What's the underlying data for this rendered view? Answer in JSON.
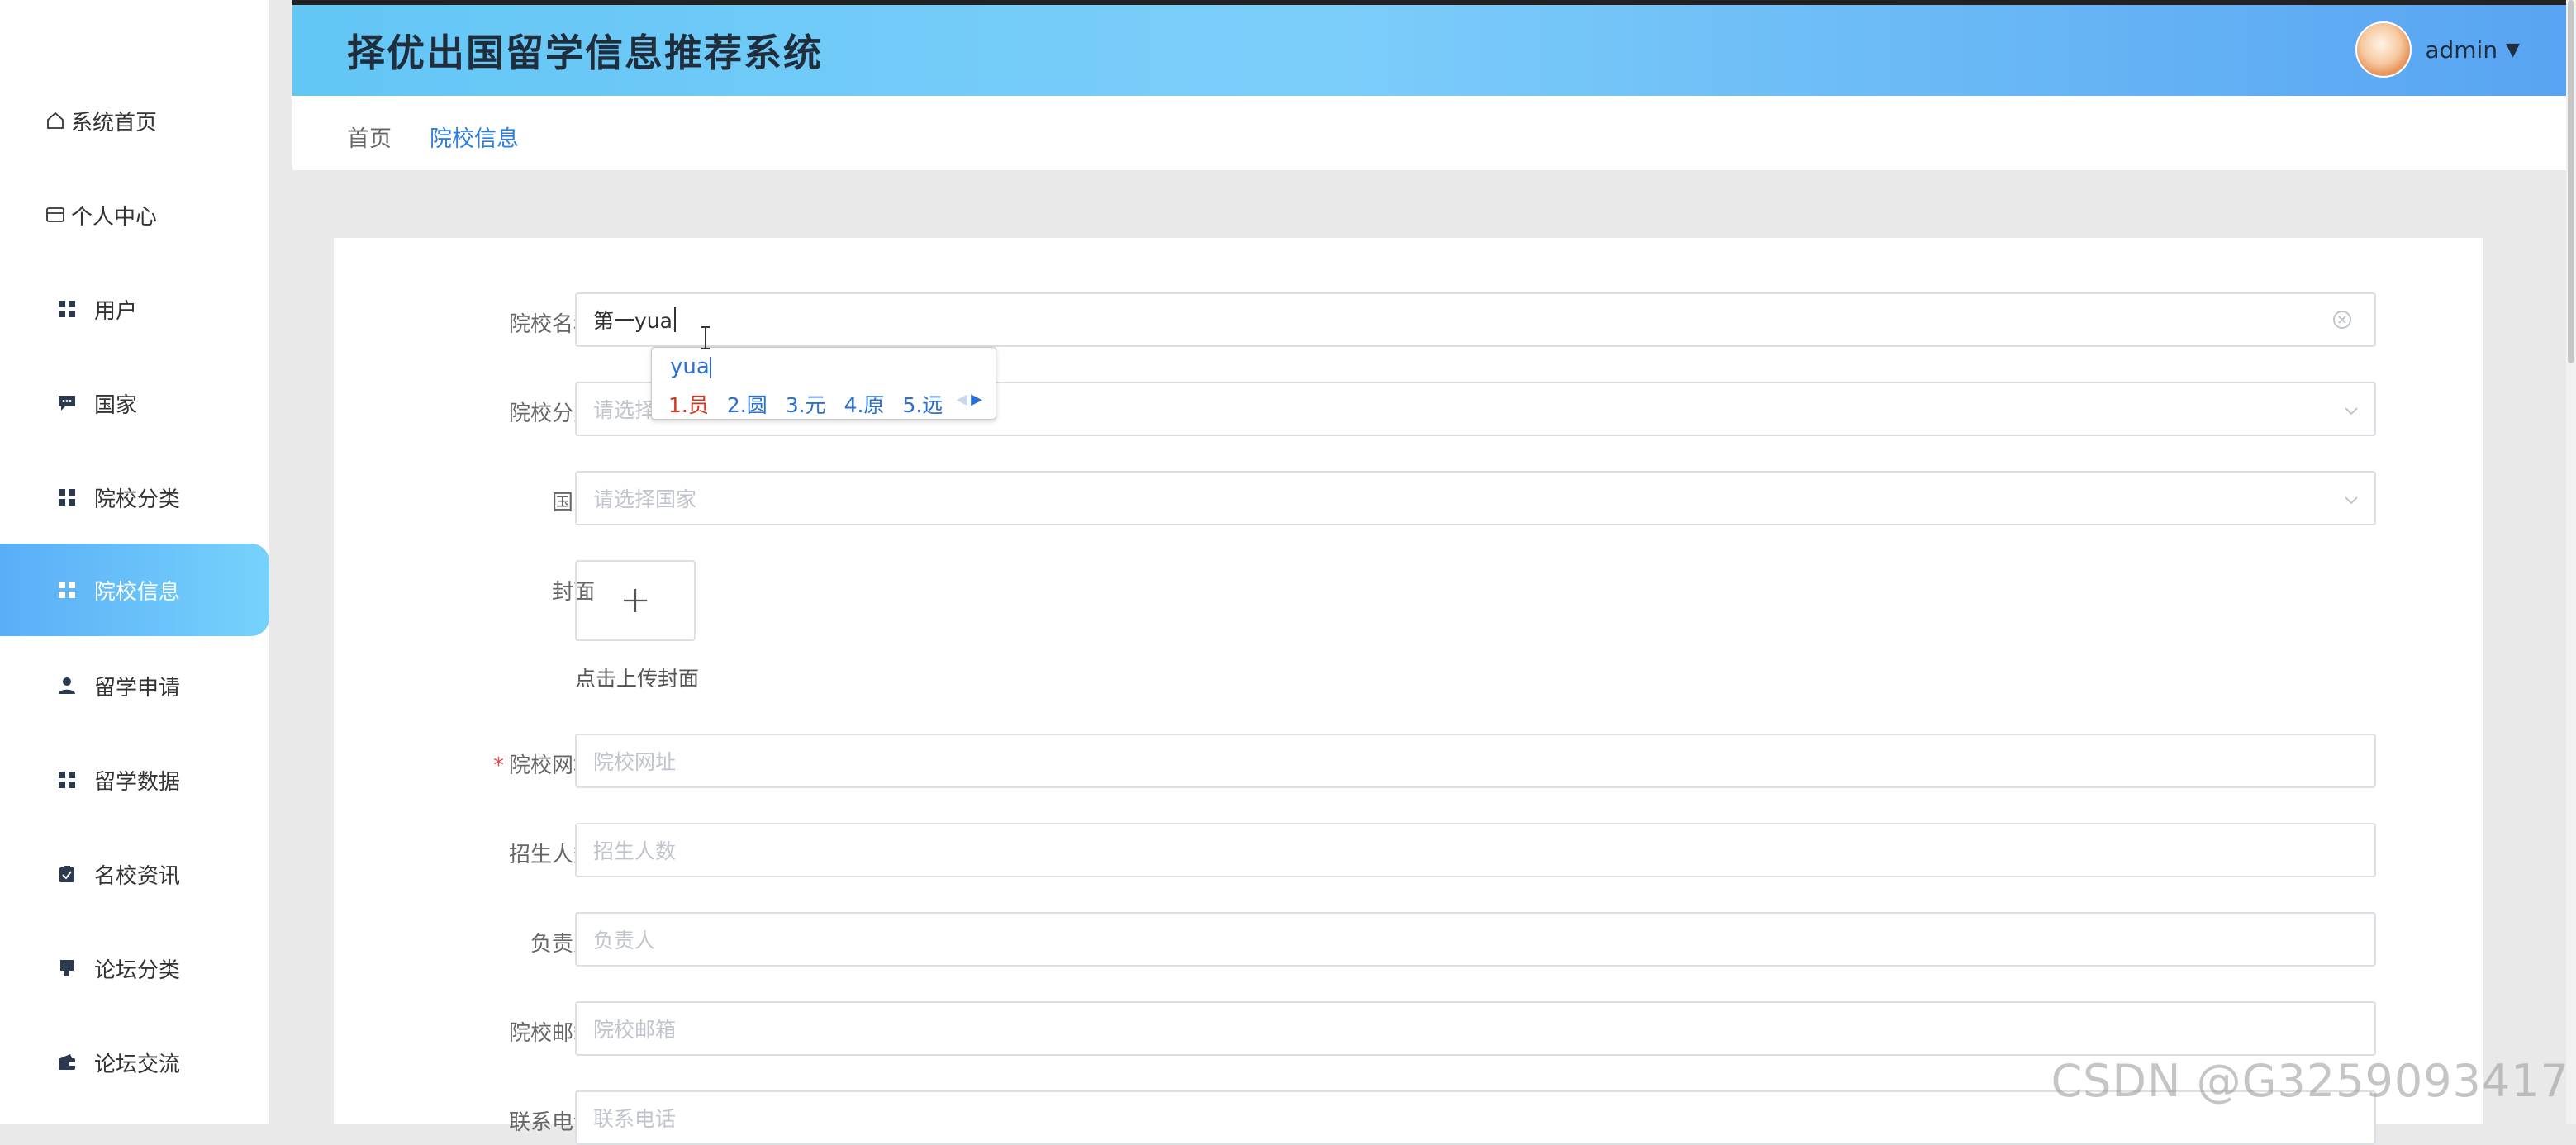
{
  "header": {
    "title": "择优出国留学信息推荐系统",
    "user_name": "admin"
  },
  "sidebar": {
    "items": [
      {
        "label": "系统首页",
        "icon": "home-icon"
      },
      {
        "label": "个人中心",
        "icon": "card-icon"
      },
      {
        "label": "用户",
        "icon": "grid-icon"
      },
      {
        "label": "国家",
        "icon": "chat-icon"
      },
      {
        "label": "院校分类",
        "icon": "grid-icon"
      },
      {
        "label": "院校信息",
        "icon": "grid-icon",
        "active": true
      },
      {
        "label": "留学申请",
        "icon": "person-icon"
      },
      {
        "label": "留学数据",
        "icon": "grid-icon"
      },
      {
        "label": "名校资讯",
        "icon": "clipboard-icon"
      },
      {
        "label": "论坛分类",
        "icon": "brush-icon"
      },
      {
        "label": "论坛交流",
        "icon": "wallet-icon"
      }
    ]
  },
  "breadcrumb": {
    "home": "首页",
    "current": "院校信息"
  },
  "form": {
    "school_name": {
      "label": "院校名称",
      "value": "第一yua"
    },
    "school_category": {
      "label": "院校分类",
      "placeholder": "请选择院校分类"
    },
    "country": {
      "label": "国家",
      "placeholder": "请选择国家"
    },
    "cover": {
      "label": "封面",
      "upload_tip": "点击上传封面"
    },
    "website": {
      "label": "院校网址",
      "placeholder": "院校网址",
      "required_mark": "*"
    },
    "enrollment": {
      "label": "招生人数",
      "placeholder": "招生人数"
    },
    "manager": {
      "label": "负责人",
      "placeholder": "负责人"
    },
    "email": {
      "label": "院校邮箱",
      "placeholder": "院校邮箱"
    },
    "phone": {
      "label": "联系电话",
      "placeholder": "联系电话"
    }
  },
  "ime": {
    "composition": "yua",
    "candidates": [
      "1.员",
      "2.圆",
      "3.元",
      "4.原",
      "5.远"
    ]
  },
  "watermark": "CSDN @G3259093417",
  "colors": {
    "accent": "#2c7fe0",
    "active_menu_start": "#5aaef7",
    "active_menu_end": "#76d2fb",
    "required": "#e84b4b"
  }
}
